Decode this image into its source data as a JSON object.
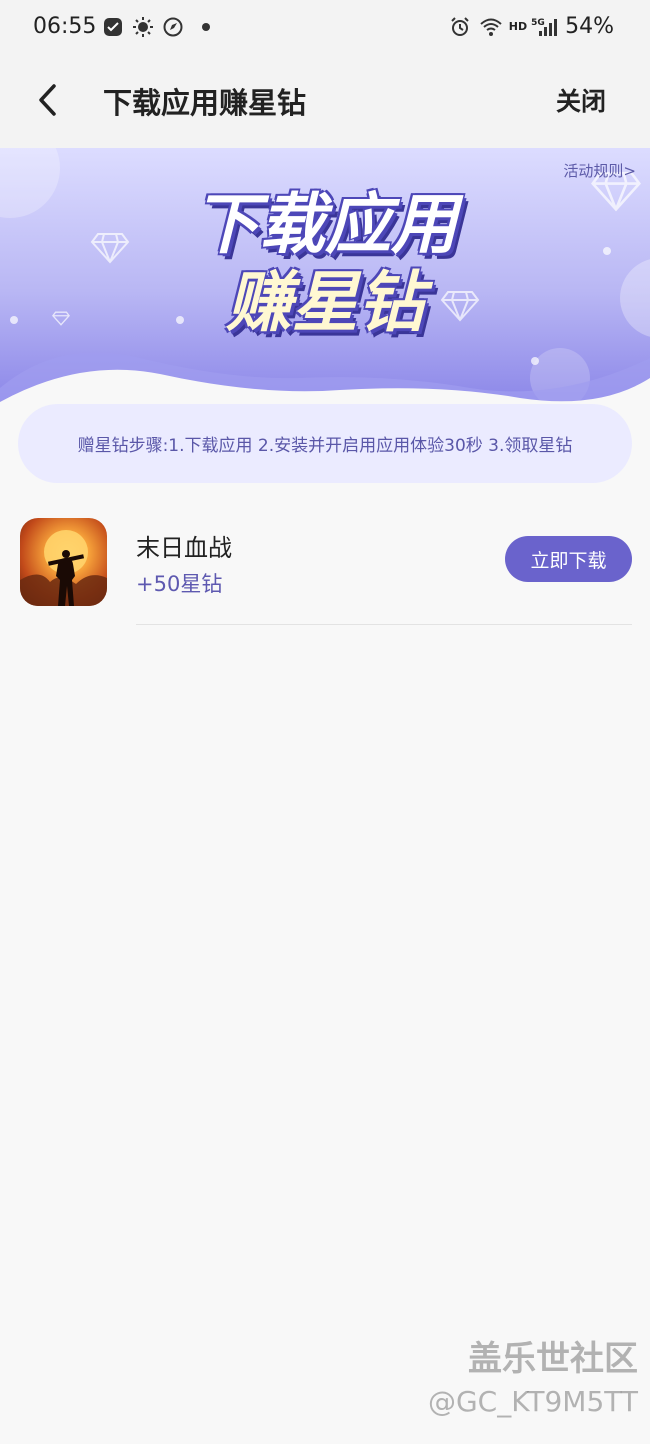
{
  "status_bar": {
    "time": "06:55",
    "network_label": "HD",
    "signal_label": "5G",
    "battery": "54%"
  },
  "nav": {
    "title": "下载应用赚星钻",
    "close_label": "关闭"
  },
  "banner": {
    "rules_link": "活动规则>",
    "title_line1": "下载应用",
    "title_line2": "赚星钻"
  },
  "steps": {
    "text": "赠星钻步骤:1.下载应用 2.安装并开启用应用体验30秒 3.领取星钻"
  },
  "apps": [
    {
      "name": "末日血战",
      "reward": "+50星钻",
      "button_label": "立即下载"
    }
  ],
  "watermark": {
    "line1": "盖乐世社区",
    "line2": "@GC_KT9M5TT"
  },
  "colors": {
    "accent": "#6a63cc",
    "banner_top": "#dcdcff",
    "banner_bottom": "#8a85e8"
  }
}
